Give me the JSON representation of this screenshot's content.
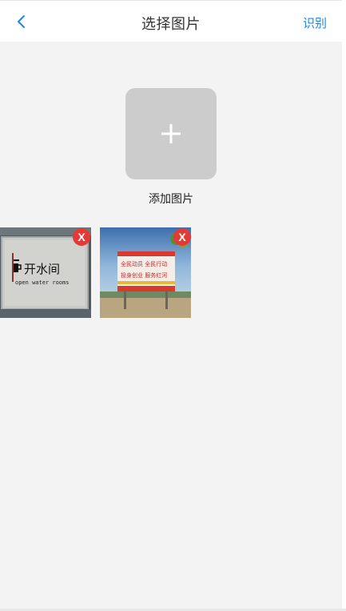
{
  "header": {
    "title": "选择图片",
    "action_label": "识别",
    "back_icon": "chevron-left-icon"
  },
  "add_image": {
    "icon": "plus-icon",
    "label": "添加图片"
  },
  "images": [
    {
      "sign_text": "开水间",
      "sign_subtext": "open water rooms",
      "remove_label": "X"
    },
    {
      "billboard_line1": "全民动员  全民行动",
      "billboard_line2": "投身创业  服务红河",
      "remove_label": "X"
    }
  ],
  "colors": {
    "accent": "#1e88e5",
    "remove": "#e53935",
    "tile": "#cccccc",
    "background": "#f3f3f3"
  }
}
